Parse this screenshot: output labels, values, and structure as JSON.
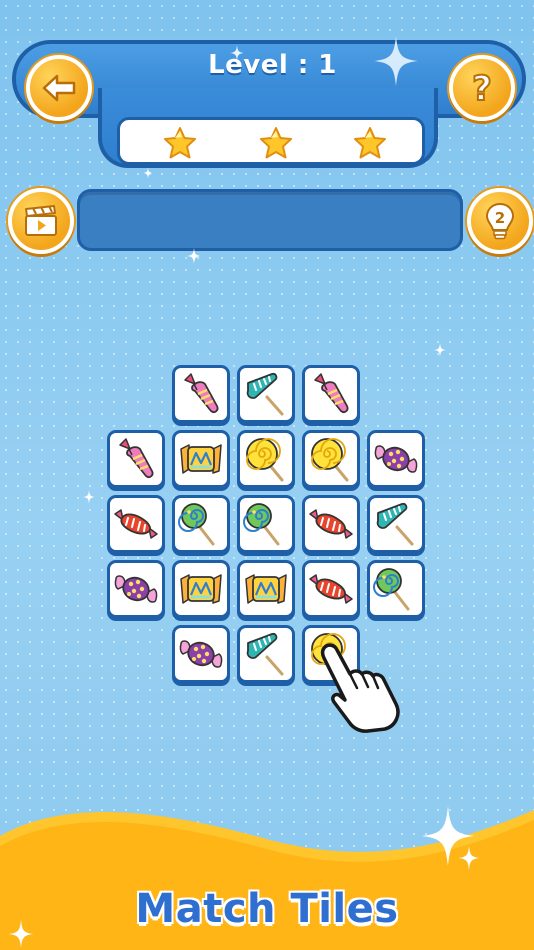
{
  "header": {
    "level_title": "Level : 1",
    "back_button": "back-arrow-icon",
    "help_button": "question-mark-icon",
    "stars_earned": 3,
    "stars_total": 3
  },
  "toolbar": {
    "video_button": "clapperboard-icon",
    "hint_button": "lightbulb-icon",
    "hint_count": "2",
    "collected_tiles": []
  },
  "board": {
    "rows": [
      [
        "",
        "triangle-candy",
        "lollipop-teal",
        "triangle-candy",
        ""
      ],
      [
        "triangle-candy",
        "wrapped-candy-gold",
        "lollipop-yellow",
        "lollipop-yellow",
        "bonbon-purple"
      ],
      [
        "wrapped-candy-red",
        "lollipop-green",
        "lollipop-green",
        "wrapped-candy-red",
        "lollipop-teal"
      ],
      [
        "bonbon-purple",
        "wrapped-candy-gold",
        "wrapped-candy-gold",
        "wrapped-candy-red",
        "lollipop-green"
      ],
      [
        "",
        "bonbon-purple",
        "lollipop-teal",
        "lollipop-yellow",
        ""
      ]
    ]
  },
  "pointer": "hand-pointer-icon",
  "footer": {
    "title": "Match Tiles"
  },
  "colors": {
    "accent_blue": "#1f5fa8",
    "button_orange": "#f3a51b",
    "star_gold": "#ffc62a",
    "footer_text": "#2e6fd0"
  }
}
